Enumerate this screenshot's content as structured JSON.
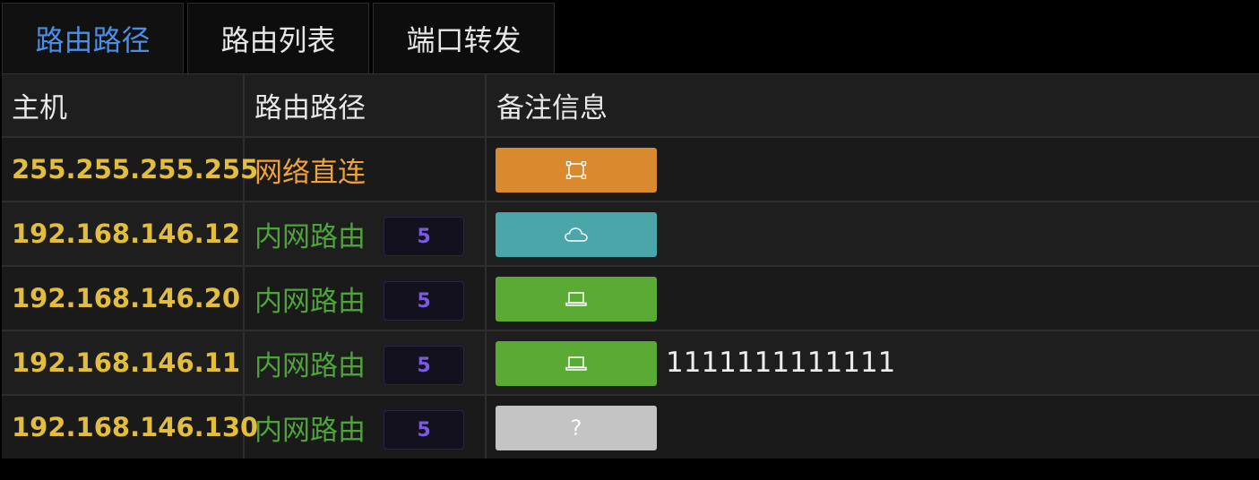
{
  "tabs": [
    {
      "label": "路由路径",
      "active": true
    },
    {
      "label": "路由列表",
      "active": false
    },
    {
      "label": "端口转发",
      "active": false
    }
  ],
  "table": {
    "headers": {
      "host": "主机",
      "route": "路由路径",
      "note": "备注信息"
    },
    "rows": [
      {
        "host": "255.255.255.255",
        "route": "网络直连",
        "route_type": "direct",
        "hops": "",
        "tag_icon": "bounding-box-icon",
        "tag_color": "#d98a2f",
        "note": ""
      },
      {
        "host": "192.168.146.12",
        "route": "内网路由",
        "route_type": "lan",
        "hops": "5",
        "tag_icon": "cloud-icon",
        "tag_color": "#4aa6a9",
        "note": ""
      },
      {
        "host": "192.168.146.20",
        "route": "内网路由",
        "route_type": "lan",
        "hops": "5",
        "tag_icon": "laptop-icon",
        "tag_color": "#5aaa35",
        "note": ""
      },
      {
        "host": "192.168.146.11",
        "route": "内网路由",
        "route_type": "lan",
        "hops": "5",
        "tag_icon": "laptop-icon",
        "tag_color": "#5aaa35",
        "note": "1111111111111"
      },
      {
        "host": "192.168.146.130",
        "route": "内网路由",
        "route_type": "lan",
        "hops": "5",
        "tag_icon": "question-icon",
        "tag_color": "#c4c4c4",
        "tag_text": "?",
        "note": ""
      }
    ]
  },
  "colors": {
    "active_tab": "#4a8fe7",
    "host": "#e3bd3c",
    "route_direct": "#f0a23a",
    "route_lan": "#4ea33a",
    "hop_badge": "#7b5ce0"
  }
}
